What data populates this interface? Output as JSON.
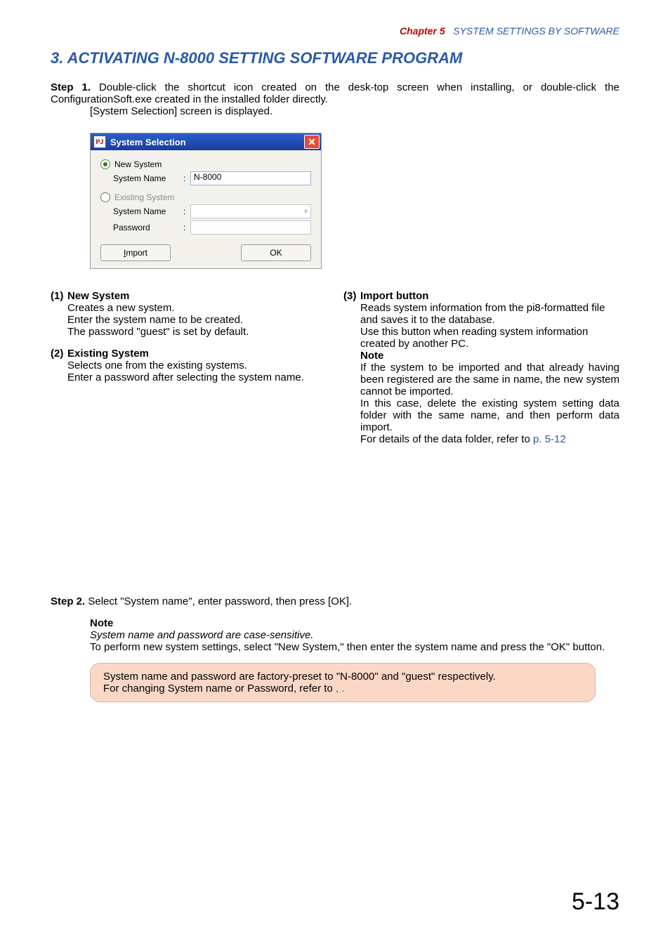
{
  "header": {
    "chapter": "Chapter 5",
    "section": "SYSTEM SETTINGS BY SOFTWARE"
  },
  "heading": "3. ACTIVATING N-8000 SETTING SOFTWARE PROGRAM",
  "step1": {
    "label": "Step 1.",
    "line1": "Double-click the shortcut icon created on the desk-top screen when installing, or double-click the ConfigurationSoft.exe created in the installed folder directly.",
    "line2": "[System Selection] screen is displayed."
  },
  "dialog": {
    "title": "System Selection",
    "new_label": "New System",
    "existing_label": "Existing System",
    "sysname_label": "System Name",
    "password_label": "Password",
    "sysname_value": "N-8000",
    "import_btn_prefix": "I",
    "import_btn_rest": "mport",
    "ok_btn": "OK"
  },
  "col1": {
    "i1": {
      "num": "(1)",
      "title": "New System",
      "l1": "Creates a new system.",
      "l2": "Enter the system name to be created.",
      "l3": "The password \"guest\" is set by default."
    },
    "i2": {
      "num": "(2)",
      "title": "Existing System",
      "l1": "Selects one from the existing systems.",
      "l2": "Enter a password after selecting the system name."
    }
  },
  "col2": {
    "i3": {
      "num": "(3)",
      "title": "Import button",
      "l1": "Reads system information from the pi8-formatted file and saves it to the database.",
      "l2": "Use this button when reading system information created by another PC.",
      "note": "Note",
      "n1": "If the system to be imported and that already having been registered are the same in name, the new system cannot be imported.",
      "n2": "In this case, delete the existing system setting data folder with the same name, and then perform data import.",
      "n3a": "For details of the data folder, refer to ",
      "n3link": "p. 5-12"
    }
  },
  "step2": {
    "label": "Step 2.",
    "line1": "Select \"System name\", enter password, then press [OK].",
    "note": "Note",
    "n1": "System name and password are case-sensitive.",
    "n2": "To perform new system settings, select \"New System,\" then enter the system name and press the \"OK\" button."
  },
  "tip": {
    "l1": "System name and password are factory-preset to \"N-8000\" and \"guest\" respectively.",
    "l2a": "For changing System name or Password, refer to ",
    "l2b": ", ."
  },
  "page_number": "5-13"
}
